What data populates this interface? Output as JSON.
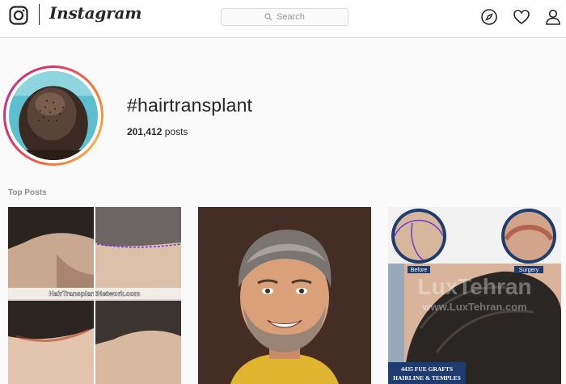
{
  "header": {
    "wordmark": "Instagram",
    "search_placeholder": "Search",
    "icons": [
      "instagram-logo-icon",
      "search-icon",
      "compass-icon",
      "heart-icon",
      "profile-icon"
    ]
  },
  "profile": {
    "hashtag": "#hairtransplant",
    "post_count": "201,412",
    "post_count_label": "posts"
  },
  "top_posts": {
    "title": "Top Posts",
    "posts": [
      {
        "watermark": "HairTransplantNetwork.com"
      },
      {},
      {
        "before_label": "Before",
        "after_label": "Surgery",
        "watermark_line1": "LuxTehran",
        "watermark_line2": "www.LuxTehran.com",
        "caption_line1": "4435 FUE GRAFTS",
        "caption_line2": "HAIRLINE & TEMPLES"
      }
    ]
  },
  "colors": {
    "accent_ring": "#e1306c",
    "text": "#262626",
    "muted": "#8e8e8e",
    "border": "#dbdbdb"
  }
}
